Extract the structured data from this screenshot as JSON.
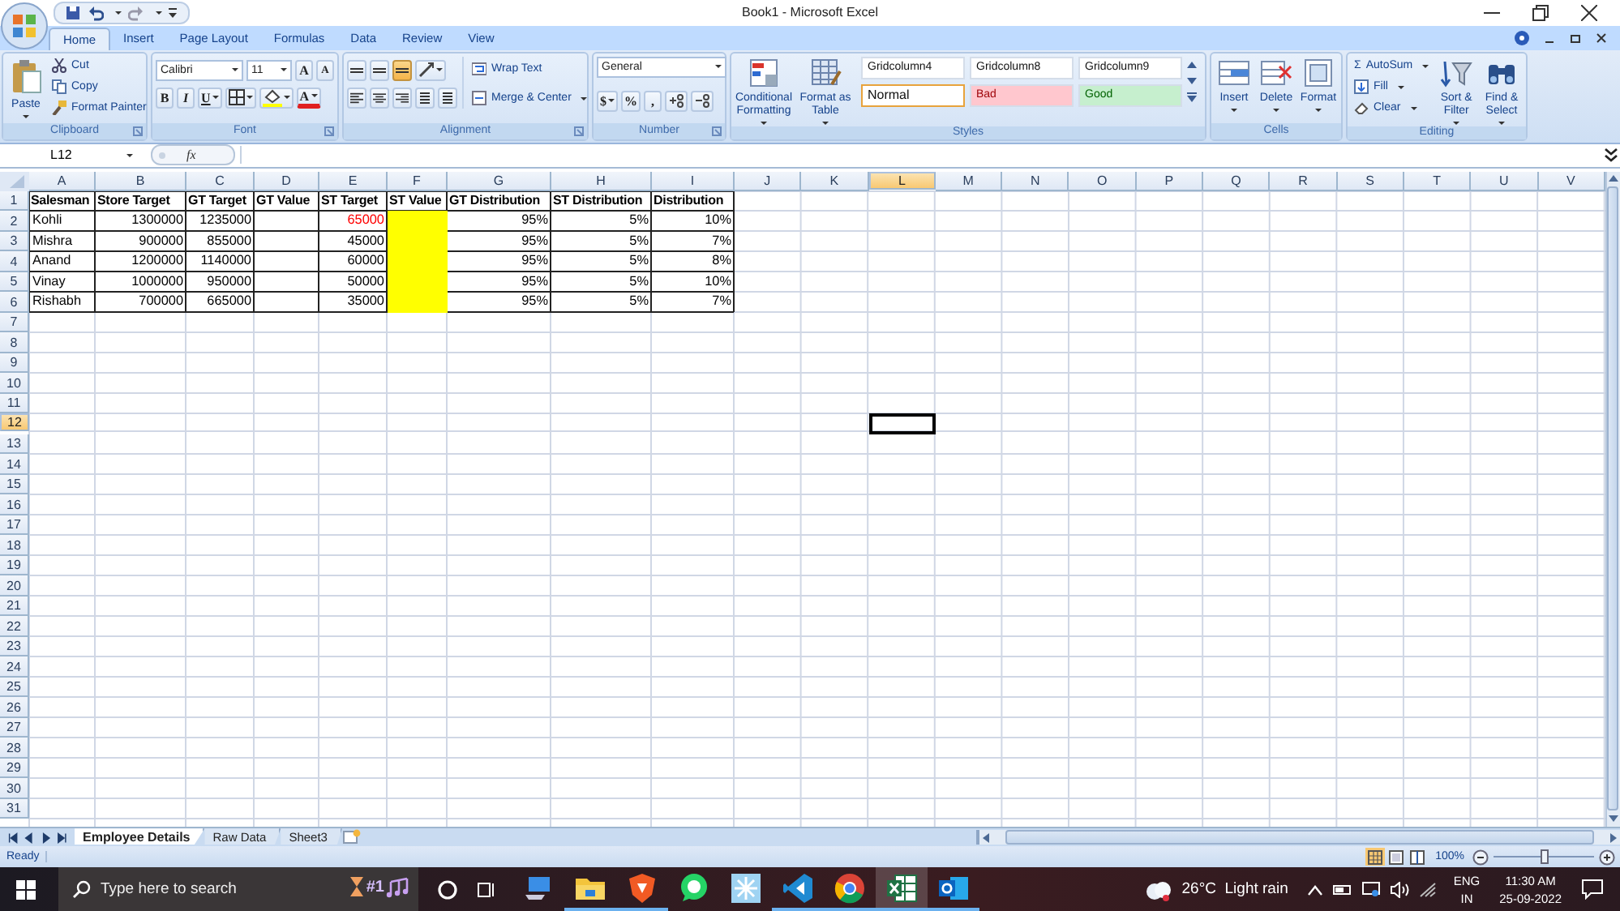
{
  "window": {
    "title": "Book1 - Microsoft Excel"
  },
  "ribbon_tabs": [
    {
      "label": "Home",
      "selected": true
    },
    {
      "label": "Insert",
      "selected": false
    },
    {
      "label": "Page Layout",
      "selected": false
    },
    {
      "label": "Formulas",
      "selected": false
    },
    {
      "label": "Data",
      "selected": false
    },
    {
      "label": "Review",
      "selected": false
    },
    {
      "label": "View",
      "selected": false
    }
  ],
  "ribbon": {
    "clipboard": {
      "label": "Clipboard",
      "paste": "Paste",
      "cut": "Cut",
      "copy": "Copy",
      "format_painter": "Format Painter"
    },
    "font": {
      "label": "Font",
      "name": "Calibri",
      "size": "11",
      "grow": "A",
      "shrink": "A",
      "bold": "B",
      "italic": "I",
      "underline": "U",
      "text_color": "A"
    },
    "alignment": {
      "label": "Alignment",
      "wrap_text": "Wrap Text",
      "merge": "Merge & Center"
    },
    "number": {
      "label": "Number",
      "format": "General",
      "currency": "$",
      "percent": "%",
      "comma": ","
    },
    "styles": {
      "label": "Styles",
      "conditional": "Conditional Formatting",
      "format_table": "Format as Table",
      "gallery": [
        {
          "label": "Gridcolumn4",
          "kind": "plain",
          "selected": false
        },
        {
          "label": "Gridcolumn8",
          "kind": "plain",
          "selected": false
        },
        {
          "label": "Gridcolumn9",
          "kind": "plain",
          "selected": false
        },
        {
          "label": "Normal",
          "kind": "normal",
          "selected": true
        },
        {
          "label": "Bad",
          "kind": "bad",
          "selected": false
        },
        {
          "label": "Good",
          "kind": "good",
          "selected": false
        }
      ]
    },
    "cells": {
      "label": "Cells",
      "buttons": [
        {
          "label": "Insert",
          "kind": "insert"
        },
        {
          "label": "Delete",
          "kind": "delete"
        },
        {
          "label": "Format",
          "kind": "format"
        }
      ]
    },
    "editing": {
      "label": "Editing",
      "sigma": "Σ",
      "autosum": "AutoSum",
      "fill": "Fill",
      "clear": "Clear",
      "sort": "Sort & Filter",
      "find": "Find & Select"
    }
  },
  "formula_bar": {
    "name_box": "L12",
    "function_label": "fx"
  },
  "sheet": {
    "columns": [
      {
        "letter": "A",
        "selected": false
      },
      {
        "letter": "B",
        "selected": false
      },
      {
        "letter": "C",
        "selected": false
      },
      {
        "letter": "D",
        "selected": false
      },
      {
        "letter": "E",
        "selected": false
      },
      {
        "letter": "F",
        "selected": false
      },
      {
        "letter": "G",
        "selected": false
      },
      {
        "letter": "H",
        "selected": false
      },
      {
        "letter": "I",
        "selected": false
      },
      {
        "letter": "J",
        "selected": false
      },
      {
        "letter": "K",
        "selected": false
      },
      {
        "letter": "L",
        "selected": true
      },
      {
        "letter": "M",
        "selected": false
      },
      {
        "letter": "N",
        "selected": false
      },
      {
        "letter": "O",
        "selected": false
      },
      {
        "letter": "P",
        "selected": false
      },
      {
        "letter": "Q",
        "selected": false
      },
      {
        "letter": "R",
        "selected": false
      },
      {
        "letter": "S",
        "selected": false
      },
      {
        "letter": "T",
        "selected": false
      },
      {
        "letter": "U",
        "selected": false
      },
      {
        "letter": "V",
        "selected": false
      }
    ],
    "rows": [
      {
        "number": "1",
        "selected": false,
        "cells": [
          {
            "kind": "header",
            "text": "Salesman"
          },
          {
            "kind": "header",
            "text": "Store Target"
          },
          {
            "kind": "header",
            "text": "GT Target"
          },
          {
            "kind": "header",
            "text": "GT Value"
          },
          {
            "kind": "header",
            "text": "ST Target"
          },
          {
            "kind": "header",
            "text": "ST Value"
          },
          {
            "kind": "header",
            "text": "GT Distribution"
          },
          {
            "kind": "header",
            "text": "ST Distribution"
          },
          {
            "kind": "header",
            "text": "Distribution"
          }
        ]
      },
      {
        "number": "2",
        "selected": false,
        "cells": [
          {
            "kind": "text",
            "text": "Kohli"
          },
          {
            "kind": "number",
            "text": "1300000"
          },
          {
            "kind": "number",
            "text": "1235000"
          },
          {
            "kind": "empty"
          },
          {
            "kind": "number",
            "text": "65000",
            "color": "#ff0000"
          },
          {
            "kind": "empty",
            "highlighted": true
          },
          {
            "kind": "number",
            "text": "95%"
          },
          {
            "kind": "number",
            "text": "5%"
          },
          {
            "kind": "number",
            "text": "10%"
          }
        ]
      },
      {
        "number": "3",
        "selected": false,
        "cells": [
          {
            "kind": "text",
            "text": "Mishra"
          },
          {
            "kind": "number",
            "text": "900000"
          },
          {
            "kind": "number",
            "text": "855000"
          },
          {
            "kind": "empty"
          },
          {
            "kind": "number",
            "text": "45000"
          },
          {
            "kind": "empty",
            "highlighted": true
          },
          {
            "kind": "number",
            "text": "95%"
          },
          {
            "kind": "number",
            "text": "5%"
          },
          {
            "kind": "number",
            "text": "7%"
          }
        ]
      },
      {
        "number": "4",
        "selected": false,
        "cells": [
          {
            "kind": "text",
            "text": "Anand"
          },
          {
            "kind": "number",
            "text": "1200000"
          },
          {
            "kind": "number",
            "text": "1140000"
          },
          {
            "kind": "empty"
          },
          {
            "kind": "number",
            "text": "60000"
          },
          {
            "kind": "empty",
            "highlighted": true
          },
          {
            "kind": "number",
            "text": "95%"
          },
          {
            "kind": "number",
            "text": "5%"
          },
          {
            "kind": "number",
            "text": "8%"
          }
        ]
      },
      {
        "number": "5",
        "selected": false,
        "cells": [
          {
            "kind": "text",
            "text": "Vinay"
          },
          {
            "kind": "number",
            "text": "1000000"
          },
          {
            "kind": "number",
            "text": "950000"
          },
          {
            "kind": "empty"
          },
          {
            "kind": "number",
            "text": "50000"
          },
          {
            "kind": "empty",
            "highlighted": true
          },
          {
            "kind": "number",
            "text": "95%"
          },
          {
            "kind": "number",
            "text": "5%"
          },
          {
            "kind": "number",
            "text": "10%"
          }
        ]
      },
      {
        "number": "6",
        "selected": false,
        "cells": [
          {
            "kind": "text",
            "text": "Rishabh"
          },
          {
            "kind": "number",
            "text": "700000"
          },
          {
            "kind": "number",
            "text": "665000"
          },
          {
            "kind": "empty"
          },
          {
            "kind": "number",
            "text": "35000"
          },
          {
            "kind": "empty",
            "highlighted": true
          },
          {
            "kind": "number",
            "text": "95%"
          },
          {
            "kind": "number",
            "text": "5%"
          },
          {
            "kind": "number",
            "text": "7%"
          }
        ]
      },
      {
        "number": "7",
        "selected": false
      },
      {
        "number": "8",
        "selected": false
      },
      {
        "number": "9",
        "selected": false
      },
      {
        "number": "10",
        "selected": false
      },
      {
        "number": "11",
        "selected": false
      },
      {
        "number": "12",
        "selected": true
      },
      {
        "number": "13",
        "selected": false
      },
      {
        "number": "14",
        "selected": false
      },
      {
        "number": "15",
        "selected": false
      },
      {
        "number": "16",
        "selected": false
      },
      {
        "number": "17",
        "selected": false
      },
      {
        "number": "18",
        "selected": false
      },
      {
        "number": "19",
        "selected": false
      },
      {
        "number": "20",
        "selected": false
      },
      {
        "number": "21",
        "selected": false
      },
      {
        "number": "22",
        "selected": false
      },
      {
        "number": "23",
        "selected": false
      },
      {
        "number": "24",
        "selected": false
      },
      {
        "number": "25",
        "selected": false
      },
      {
        "number": "26",
        "selected": false
      },
      {
        "number": "27",
        "selected": false
      },
      {
        "number": "28",
        "selected": false
      },
      {
        "number": "29",
        "selected": false
      },
      {
        "number": "30",
        "selected": false
      },
      {
        "number": "31",
        "selected": false
      }
    ]
  },
  "sheet_tabs": [
    {
      "label": "Employee Details",
      "selected": true
    },
    {
      "label": "Raw Data",
      "selected": false
    },
    {
      "label": "Sheet3",
      "selected": false
    }
  ],
  "status_bar": {
    "text": "Ready",
    "views": [
      {
        "kind": "normal",
        "selected": true
      },
      {
        "kind": "layout",
        "selected": false
      },
      {
        "kind": "break",
        "selected": false
      }
    ],
    "zoom": "100%",
    "zoom_slider": {
      "level": 0.5
    }
  },
  "taskbar": {
    "search": {
      "placeholder": "Type here to search",
      "highlight": "#1"
    },
    "apps": [
      {
        "kind": "monitor",
        "running": false,
        "active": false
      },
      {
        "kind": "folder",
        "running": true,
        "active": false
      },
      {
        "kind": "shield",
        "running": true,
        "active": false
      },
      {
        "kind": "chat",
        "running": false,
        "active": false
      },
      {
        "kind": "snowflake",
        "running": false,
        "active": false
      },
      {
        "kind": "code",
        "running": true,
        "active": false
      },
      {
        "kind": "browser",
        "running": true,
        "active": false
      },
      {
        "kind": "spreadsheet",
        "running": true,
        "active": true
      },
      {
        "kind": "mail",
        "running": true,
        "active": false
      }
    ],
    "weather": "26°C  Light rain",
    "language": "ENG",
    "region": "IN",
    "time": "11:30 AM",
    "date": "25-09-2022"
  }
}
